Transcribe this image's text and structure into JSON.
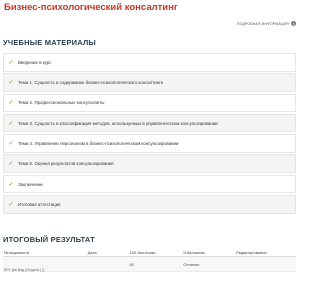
{
  "header": {
    "title": "Бизнес-психологический консалтинг",
    "more_info_label": "ПОДРОБНАЯ ИНФОРМАЦИЯ",
    "more_info_icon": "info-icon"
  },
  "materials": {
    "section_title": "УЧЕБНЫЕ МАТЕРИАЛЫ",
    "check_icon": "check-icon",
    "accent_color": "#8bc34a",
    "items": [
      {
        "label": "Введение в курс"
      },
      {
        "label": "Тема 1. Сущность и содержание бизнес-психологического консалтинга"
      },
      {
        "label": "Тема 2. Профессиональные консультанты"
      },
      {
        "label": "Тема 3. Сущность и классификация методов, используемых в управленческом консультировании"
      },
      {
        "label": "Тема 4. Управление персоналом в бизнес-психологическом консультировании"
      },
      {
        "label": "Тема 5. Оценка результатов консультирования"
      },
      {
        "label": "Заключение"
      },
      {
        "label": "Итоговая аттестация"
      }
    ]
  },
  "result": {
    "section_title": "ИТОГОВЫЙ РЕЗУЛЬТАТ",
    "columns": [
      "№ ведомости",
      "Дата",
      "100-балльная",
      "5-балльная",
      "Редактирование"
    ],
    "rows": [
      [
        "",
        "",
        "92",
        "Отлично",
        ""
      ]
    ],
    "footnote": "КРУ (вп Вод (Отдыха | ))"
  }
}
